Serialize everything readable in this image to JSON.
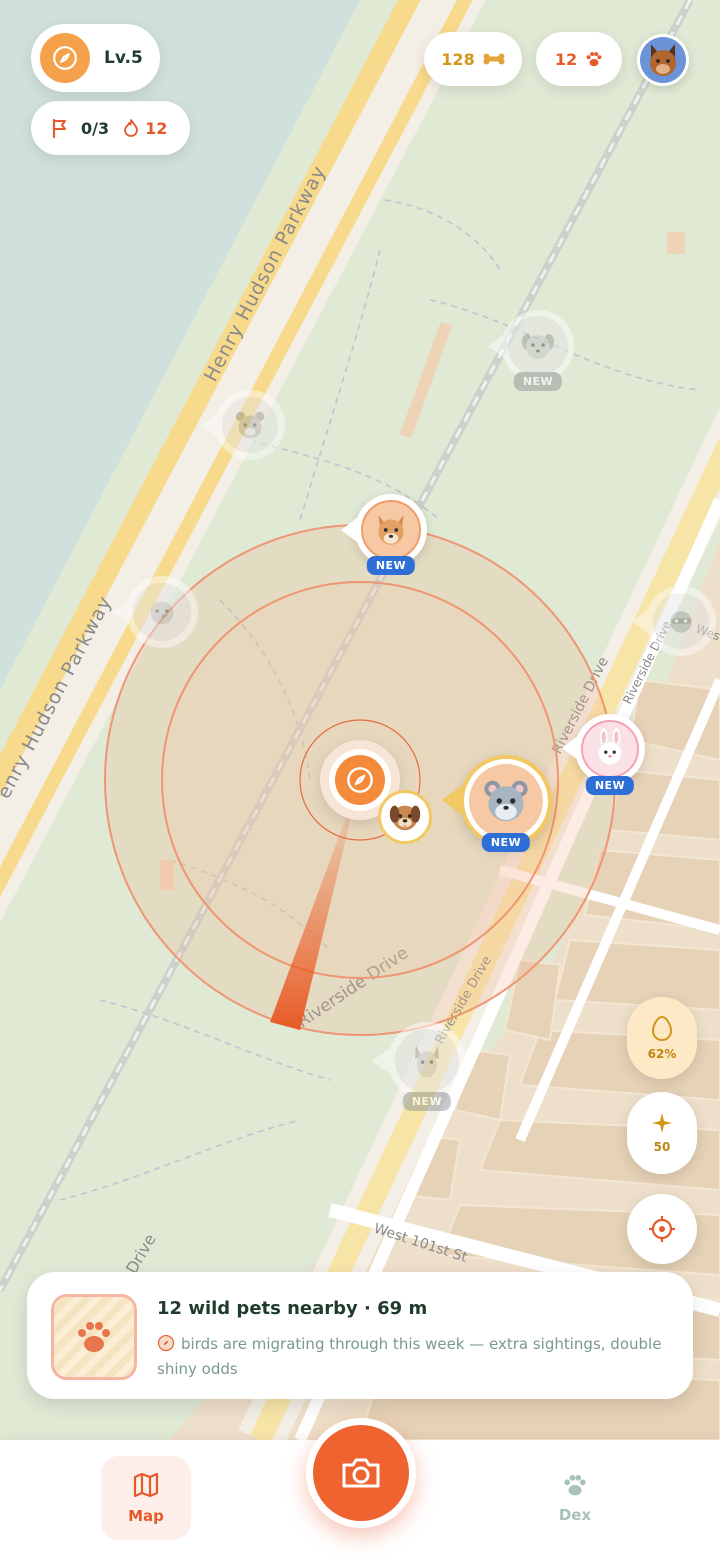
{
  "status": {
    "level": "Lv.5",
    "quests": "0/3",
    "streak": "12",
    "bones": "128",
    "paws": "12"
  },
  "map": {
    "roads": {
      "parkway_upper": "Henry Hudson Parkway",
      "parkway_lower": "enry Hudson Parkway",
      "riverside_main": "Riverside Drive",
      "riverside_lower": "Riverside Drive",
      "riverside_right_1": "Riverside Drive",
      "riverside_right_2": "Riverside Drive",
      "west_edge": "Wes",
      "west_101": "West 101st St",
      "drive_left": "Drive"
    },
    "colors": {
      "water": "#cfe0dd",
      "park": "#dfe9d4",
      "road_major": "#f7da8c",
      "city": "#eedfca",
      "accent": "#ef6a2f"
    }
  },
  "pets": {
    "new_label": "NEW"
  },
  "side": {
    "egg_progress": "62%",
    "stars": "50"
  },
  "info": {
    "title": "12 wild pets nearby · 69 m",
    "event": "birds are migrating through this week — extra sightings, double shiny odds"
  },
  "nav": {
    "map": "Map",
    "dex": "Dex"
  },
  "icons": {
    "compass": "compass-icon",
    "flag": "flag-icon",
    "flame": "flame-icon",
    "bone": "bone-icon",
    "paw": "paw-icon",
    "egg": "egg-icon",
    "star": "sparkle-icon",
    "locate": "crosshair-icon",
    "camera": "camera-icon",
    "map": "map-icon"
  }
}
